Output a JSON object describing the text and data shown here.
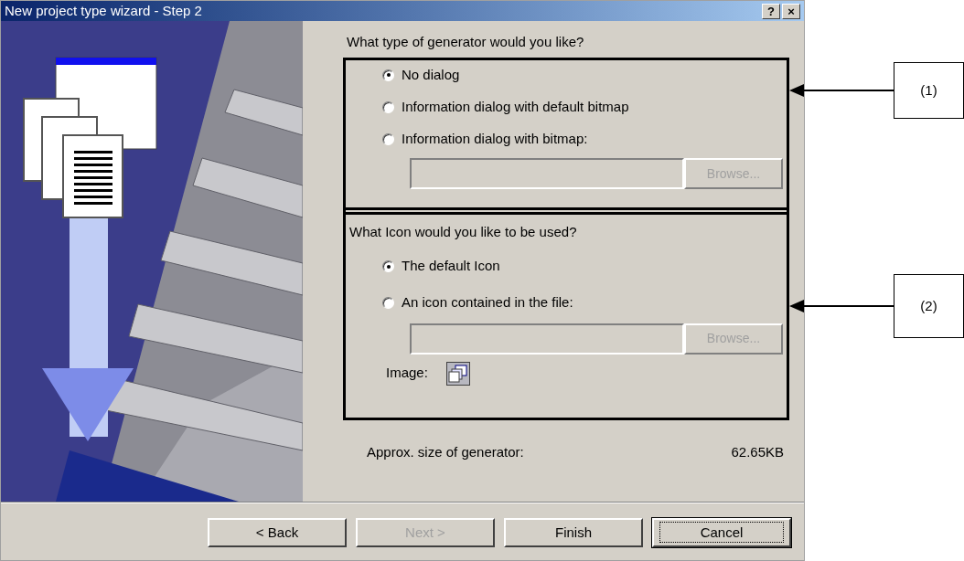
{
  "window": {
    "title": "New project type wizard - Step 2",
    "title_buttons": [
      "?",
      "×"
    ]
  },
  "generator": {
    "question": "What type of generator would you like?",
    "options": [
      {
        "label": "No dialog",
        "selected": true
      },
      {
        "label": "Information dialog with default bitmap",
        "selected": false
      },
      {
        "label": "Information dialog with bitmap:",
        "selected": false
      }
    ],
    "browse": {
      "label": "Browse...",
      "disabled": true
    }
  },
  "icon": {
    "question": "What Icon would you like to be used?",
    "options": [
      {
        "label": "The default Icon",
        "selected": true
      },
      {
        "label": "An icon contained in the file:",
        "selected": false
      }
    ],
    "browse": {
      "label": "Browse...",
      "disabled": true
    },
    "image_label": "Image:"
  },
  "size": {
    "label": "Approx. size of generator:",
    "value": "62.65KB"
  },
  "buttons": [
    {
      "label": "< Back",
      "disabled": false,
      "focused": false
    },
    {
      "label": "Next >",
      "disabled": true,
      "focused": false
    },
    {
      "label": "Finish",
      "disabled": false,
      "focused": false
    },
    {
      "label": "Cancel",
      "disabled": false,
      "focused": true
    }
  ],
  "annotations": [
    {
      "label": "(1)"
    },
    {
      "label": "(2)"
    }
  ]
}
